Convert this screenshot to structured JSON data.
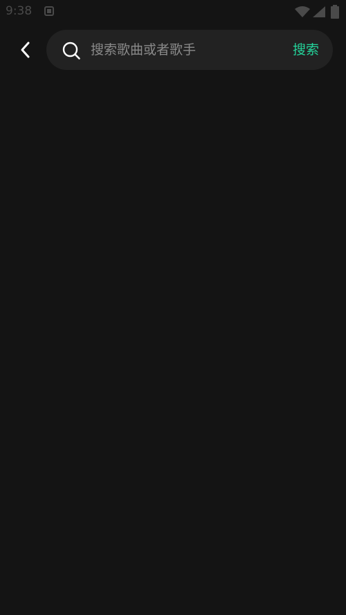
{
  "status_bar": {
    "time": "9:38",
    "icons": [
      "notification-icon",
      "wifi-icon",
      "signal-icon",
      "battery-icon"
    ]
  },
  "header": {
    "back_icon": "chevron-left-icon",
    "search": {
      "icon": "search-icon",
      "value": "",
      "placeholder": "搜索歌曲或者歌手",
      "submit_label": "搜索"
    }
  },
  "colors": {
    "background": "#141414",
    "search_bar_bg": "#222222",
    "accent": "#24d39a",
    "placeholder": "#8a8a8a"
  }
}
